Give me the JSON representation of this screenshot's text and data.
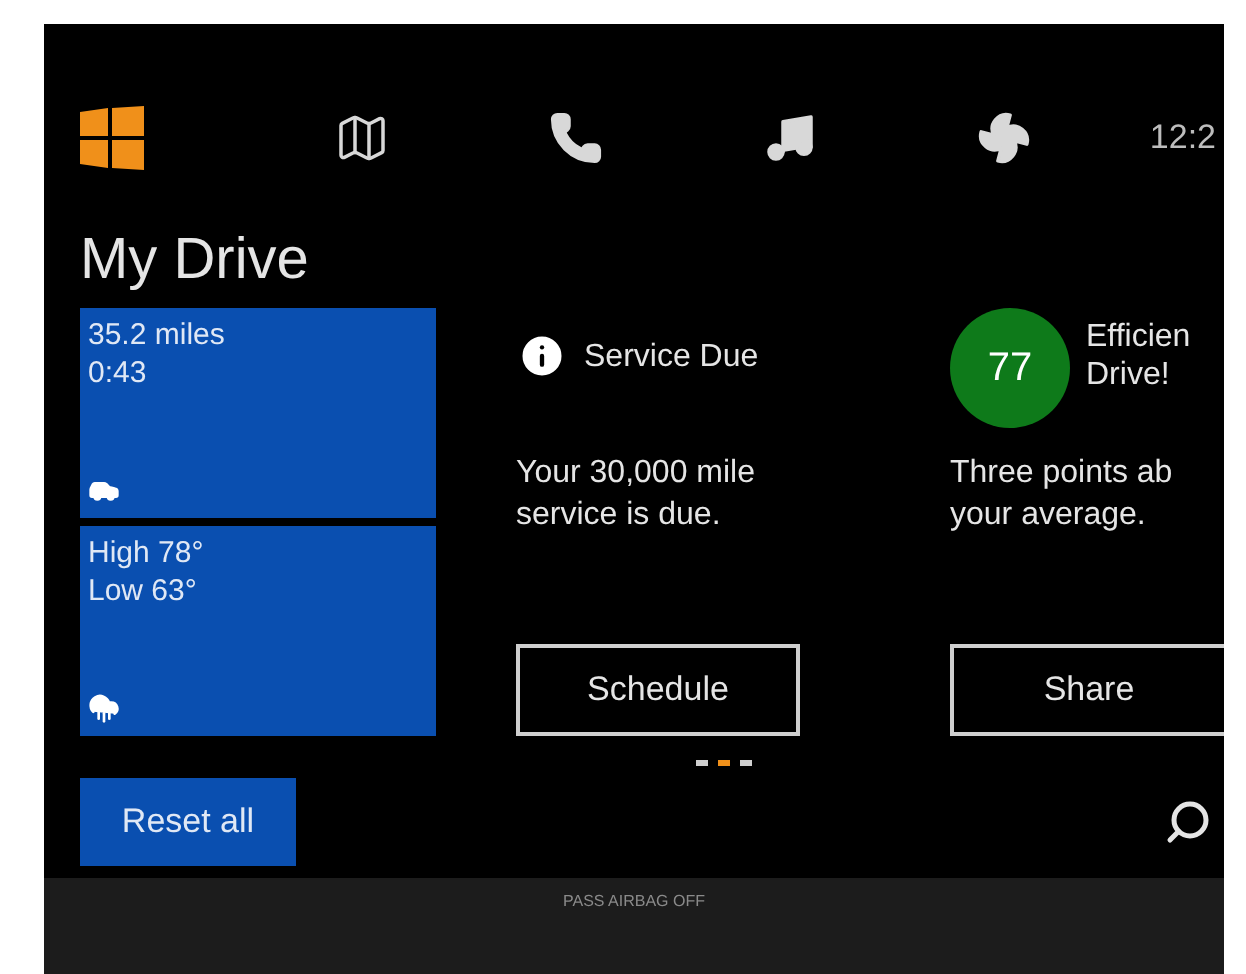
{
  "nav": [
    {
      "kind": "windows",
      "selected": true
    },
    {
      "kind": "map",
      "selected": false
    },
    {
      "kind": "phone",
      "selected": false
    },
    {
      "kind": "music",
      "selected": false
    },
    {
      "kind": "fan",
      "selected": false
    }
  ],
  "clock": "12:2",
  "title": "My Drive",
  "tiles": [
    {
      "kind": "trip",
      "lines": [
        "35.2 miles",
        "0:43"
      ]
    },
    {
      "kind": "weather",
      "lines": [
        "High 78°",
        "Low 63°"
      ]
    }
  ],
  "cards": [
    {
      "kind": "info",
      "heading": [
        "Service Due"
      ],
      "body": "Your 30,000 mile service is due.",
      "button": "Schedule"
    },
    {
      "kind": "score",
      "score": "77",
      "heading": [
        "Efficien",
        "Drive!"
      ],
      "body_lines": [
        "Three points ab",
        "your average."
      ],
      "button": "Share"
    }
  ],
  "pages": [
    {
      "selected": false
    },
    {
      "selected": true
    },
    {
      "selected": false
    }
  ],
  "reset_button": "Reset all",
  "bezel_label": "PASS AIRBAG OFF"
}
